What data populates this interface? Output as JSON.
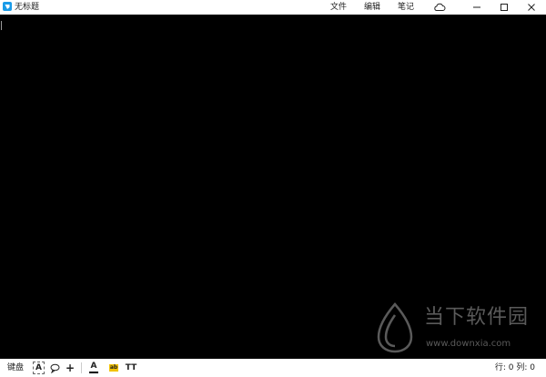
{
  "window": {
    "title": "无标题",
    "menus": {
      "file": "文件",
      "edit": "编辑",
      "notes": "笔记"
    }
  },
  "icons": {
    "app": "app-icon",
    "cloud": "cloud-icon",
    "minimize": "minimize-icon",
    "maximize": "maximize-icon",
    "close": "close-icon",
    "text-box": "text-box-icon",
    "speech-bubble": "speech-bubble-icon",
    "plus": "plus-icon",
    "font-color": "font-color-icon",
    "highlight": "highlight-icon",
    "font-size": "font-size-icon"
  },
  "colors": {
    "app_icon": "#1a9be8",
    "editor_background": "#000000",
    "highlight_marker": "#f2c200",
    "font_color_bar": "#000000"
  },
  "toolbar": {
    "keyboard_label": "键盘",
    "text_box": "A",
    "plus": "+",
    "font_color": "A",
    "highlight": "ab",
    "font_size": "TT"
  },
  "status": {
    "text": "行: 0 列: 0"
  },
  "watermark": {
    "title": "当下软件园",
    "url": "www.downxia.com"
  }
}
